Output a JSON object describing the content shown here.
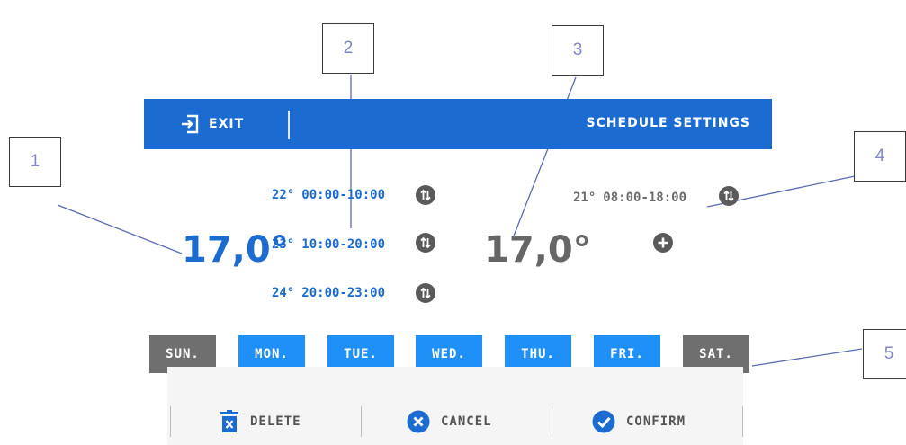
{
  "callouts": [
    "1",
    "2",
    "3",
    "4",
    "5"
  ],
  "header": {
    "exit_label": "EXIT",
    "title": "SCHEDULE SETTINGS",
    "background_color": "#1b6bd0"
  },
  "current": {
    "temperature": "17,0°",
    "periods": [
      {
        "temp": "22°",
        "range": "00:00-10:00"
      },
      {
        "temp": "23°",
        "range": "10:00-20:00"
      },
      {
        "temp": "24°",
        "range": "20:00-23:00"
      }
    ]
  },
  "other": {
    "temperature": "17,0°",
    "periods": [
      {
        "temp": "21°",
        "range": "08:00-18:00"
      }
    ]
  },
  "days": [
    {
      "label": "SUN.",
      "selected": false
    },
    {
      "label": "MON.",
      "selected": true
    },
    {
      "label": "TUE.",
      "selected": true
    },
    {
      "label": "WED.",
      "selected": true
    },
    {
      "label": "THU.",
      "selected": true
    },
    {
      "label": "FRI.",
      "selected": true
    },
    {
      "label": "SAT.",
      "selected": false
    }
  ],
  "actions": {
    "delete_label": "DELETE",
    "cancel_label": "CANCEL",
    "confirm_label": "CONFIRM"
  },
  "icons": {
    "exit": "exit-icon",
    "swap": "swap-arrows-icon",
    "add": "plus-icon",
    "delete": "trash-icon",
    "cancel": "x-circle-icon",
    "confirm": "check-circle-icon"
  },
  "colors": {
    "accent": "#1b6bd0",
    "day_selected": "#1e90f7",
    "day_unselected": "#6f6f6f",
    "icon_gray": "#5a5a5a"
  }
}
